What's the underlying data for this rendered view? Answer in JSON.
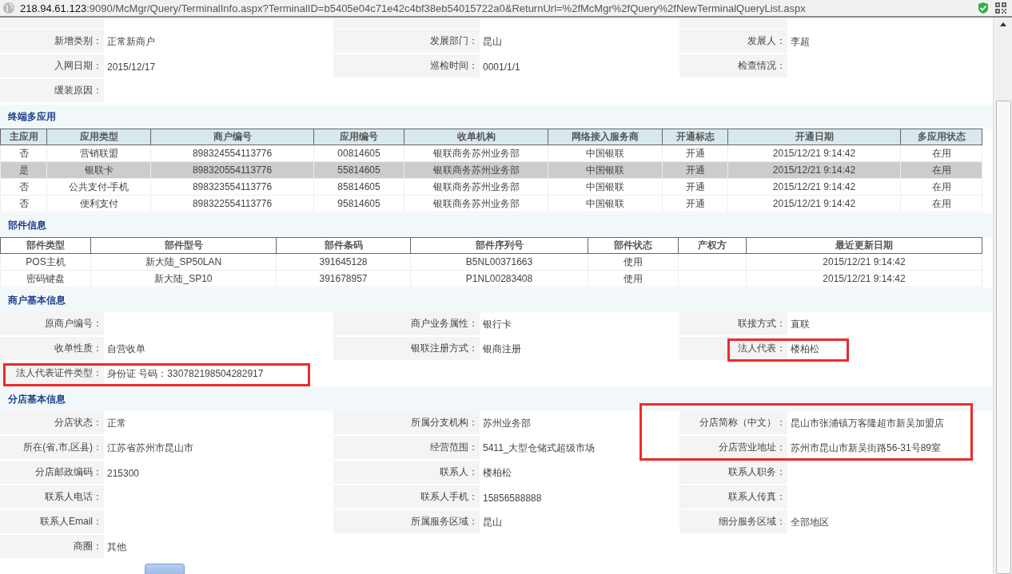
{
  "address_bar": {
    "host": "218.94.61.123",
    "path": ":9090/McMgr/Query/TerminalInfo.aspx?TerminalID=b5405e04c71e42c4bf38eb54015722a0&ReturnUrl=%2fMcMgr%2fQuery%2fNewTerminalQueryList.aspx"
  },
  "sections": [
    {
      "kind": "form",
      "partial_top": true,
      "rows": [
        [
          {
            "label": "新增类别：",
            "value": "正常新商户",
            "highlighted": false
          },
          {
            "label": "发展部门：",
            "value": "昆山",
            "highlighted": false
          },
          {
            "label": "发展人：",
            "value": "李超",
            "highlighted": false
          }
        ],
        [
          {
            "label": "入网日期：",
            "value": "2015/12/17",
            "highlighted": false
          },
          {
            "label": "巡检时间：",
            "value": "0001/1/1",
            "highlighted": false
          },
          {
            "label": "检查情况：",
            "highlighted": false
          }
        ],
        [
          {
            "label": "缓装原因：",
            "highlighted": false
          }
        ]
      ]
    },
    {
      "kind": "table",
      "title": "终端多应用",
      "header_tinted": true,
      "columns": [
        "主应用",
        "应用类型",
        "商户编号",
        "应用编号",
        "收单机构",
        "网络接入服务商",
        "开通标志",
        "开通日期",
        "多应用状态"
      ],
      "rows": [
        {
          "selected": false,
          "cells": [
            "否",
            "营销联盟",
            "898324554113776",
            "00814605",
            "银联商务苏州业务部",
            "中国银联",
            "开通",
            "2015/12/21 9:14:42",
            "在用"
          ]
        },
        {
          "selected": true,
          "cells": [
            "是",
            "银联卡",
            "898320554113776",
            "55814605",
            "银联商务苏州业务部",
            "中国银联",
            "开通",
            "2015/12/21 9:14:42",
            "在用"
          ]
        },
        {
          "selected": false,
          "cells": [
            "否",
            "公共支付-手机",
            "898323554113776",
            "85814605",
            "银联商务苏州业务部",
            "中国银联",
            "开通",
            "2015/12/21 9:14:42",
            "在用"
          ]
        },
        {
          "selected": false,
          "cells": [
            "否",
            "便利支付",
            "898322554113776",
            "95814605",
            "银联商务苏州业务部",
            "中国银联",
            "开通",
            "2015/12/21 9:14:42",
            "在用"
          ]
        }
      ]
    },
    {
      "kind": "table",
      "title": "部件信息",
      "header_tinted": false,
      "columns": [
        "部件类型",
        "部件型号",
        "部件条码",
        "部件序列号",
        "部件状态",
        "产权方",
        "最近更新日期"
      ],
      "rows": [
        {
          "selected": false,
          "cells": [
            "POS主机",
            "新大陆_SP50LAN",
            "391645128",
            "B5NL00371663",
            "使用",
            "",
            "2015/12/21 9:14:42"
          ]
        },
        {
          "selected": false,
          "cells": [
            "密码键盘",
            "新大陆_SP10",
            "391678957",
            "P1NL00283408",
            "使用",
            "",
            "2015/12/21 9:14:42"
          ]
        }
      ]
    },
    {
      "kind": "form",
      "title": "商户基本信息",
      "rows": [
        [
          {
            "label": "原商户编号：",
            "highlighted": false
          },
          {
            "label": "商户业务属性：",
            "value": "银行卡",
            "highlighted": false
          },
          {
            "label": "联接方式：",
            "value": "直联",
            "highlighted": false
          }
        ],
        [
          {
            "label": "收单性质：",
            "value": "自营收单",
            "highlighted": false
          },
          {
            "label": "银联注册方式：",
            "value": "银商注册",
            "highlighted": false
          },
          {
            "label": "法人代表：",
            "value": "楼柏松",
            "highlighted": true
          }
        ],
        [
          {
            "label": "法人代表证件类型：",
            "value": "身份证 号码：330782198504282917",
            "highlighted": true
          }
        ]
      ]
    },
    {
      "kind": "form",
      "title": "分店基本信息",
      "rows": [
        [
          {
            "label": "分店状态：",
            "value": "正常",
            "highlighted": false
          },
          {
            "label": "所属分支机构：",
            "value": "苏州业务部",
            "highlighted": false
          },
          {
            "label": "分店简称（中文）：",
            "value": "昆山市张浦镇万客隆超市新吴加盟店",
            "highlighted": true
          }
        ],
        [
          {
            "label": "所在(省,市,区县)：",
            "value": "江苏省苏州市昆山市",
            "highlighted": false
          },
          {
            "label": "经营范围：",
            "value": "5411_大型仓储式超级市场",
            "highlighted": false
          },
          {
            "label": "分店营业地址：",
            "value": "苏州市昆山市新吴街路56-31号89室",
            "highlighted": true
          }
        ],
        [
          {
            "label": "分店邮政编码：",
            "value": "215300",
            "highlighted": false
          },
          {
            "label": "联系人：",
            "value": "楼柏松",
            "highlighted": false
          },
          {
            "label": "联系人职务：",
            "highlighted": false
          }
        ],
        [
          {
            "label": "联系人电话：",
            "highlighted": false
          },
          {
            "label": "联系人手机：",
            "value": "15856588888",
            "highlighted": false
          },
          {
            "label": "联系人传真：",
            "highlighted": false
          }
        ],
        [
          {
            "label": "联系人Email：",
            "highlighted": false
          },
          {
            "label": "所属服务区域：",
            "value": "昆山",
            "highlighted": false
          },
          {
            "label": "细分服务区域：",
            "value": "全部地区",
            "highlighted": false
          }
        ],
        [
          {
            "label": "商圈：",
            "value": "其他",
            "highlighted": false
          }
        ]
      ]
    }
  ]
}
